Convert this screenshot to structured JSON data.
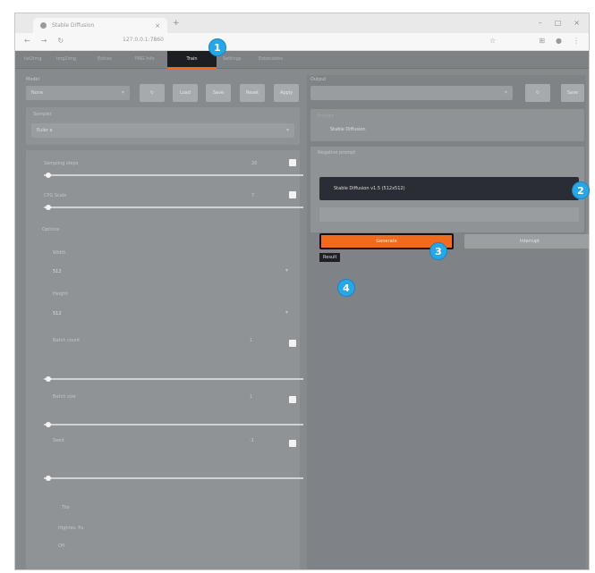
{
  "browser": {
    "tab_title": "Stable Diffusion",
    "url": "127.0.0.1:7860",
    "tab_close": "×",
    "tab_new": "+",
    "nav_back": "←",
    "nav_forward": "→",
    "nav_reload": "↻",
    "win_min": "–",
    "win_max": "□",
    "win_close": "×"
  },
  "nav_tabs": [
    "txt2img",
    "img2img",
    "Extras",
    "PNG Info",
    "Train",
    "Settings",
    "Extensions"
  ],
  "left": {
    "model_label": "Model",
    "model_value": "None",
    "buttons": [
      "↻",
      "Load",
      "Save",
      "Reset",
      "Apply"
    ],
    "sampler_label": "Sampler",
    "sampler_value": "Euler a",
    "steps_label": "Sampling steps",
    "steps_value": "20",
    "cfg_label": "CFG Scale",
    "cfg_value": "7",
    "section_label": "Options",
    "opt1_label": "Width",
    "opt1_value": "512",
    "opt2_label": "Height",
    "opt2_value": "512",
    "batch_label": "Batch count",
    "batch_value": "1",
    "size_label": "Batch size",
    "size_value": "1",
    "seed_label": "Seed",
    "seed_value": "-1",
    "footer1": "Tile",
    "footer2": "Highres. fix",
    "footer3": "Off"
  },
  "right": {
    "output_label": "Output",
    "output_button": "↻",
    "output_button2": "Save",
    "prompt_label": "Prompt",
    "prompt_value": "Stable Diffusion",
    "neg_label": "Negative prompt",
    "neg_value": "Stable Diffusion v1.5 (512x512)",
    "hint": "",
    "generate_label": "Generate",
    "secondary_label": "Interrupt",
    "result_label": "Result"
  },
  "markers": [
    "1",
    "2",
    "3",
    "4"
  ],
  "colors": {
    "accent": "#f26a1b",
    "marker": "#29a6e6",
    "dark": "#1c1e23"
  }
}
